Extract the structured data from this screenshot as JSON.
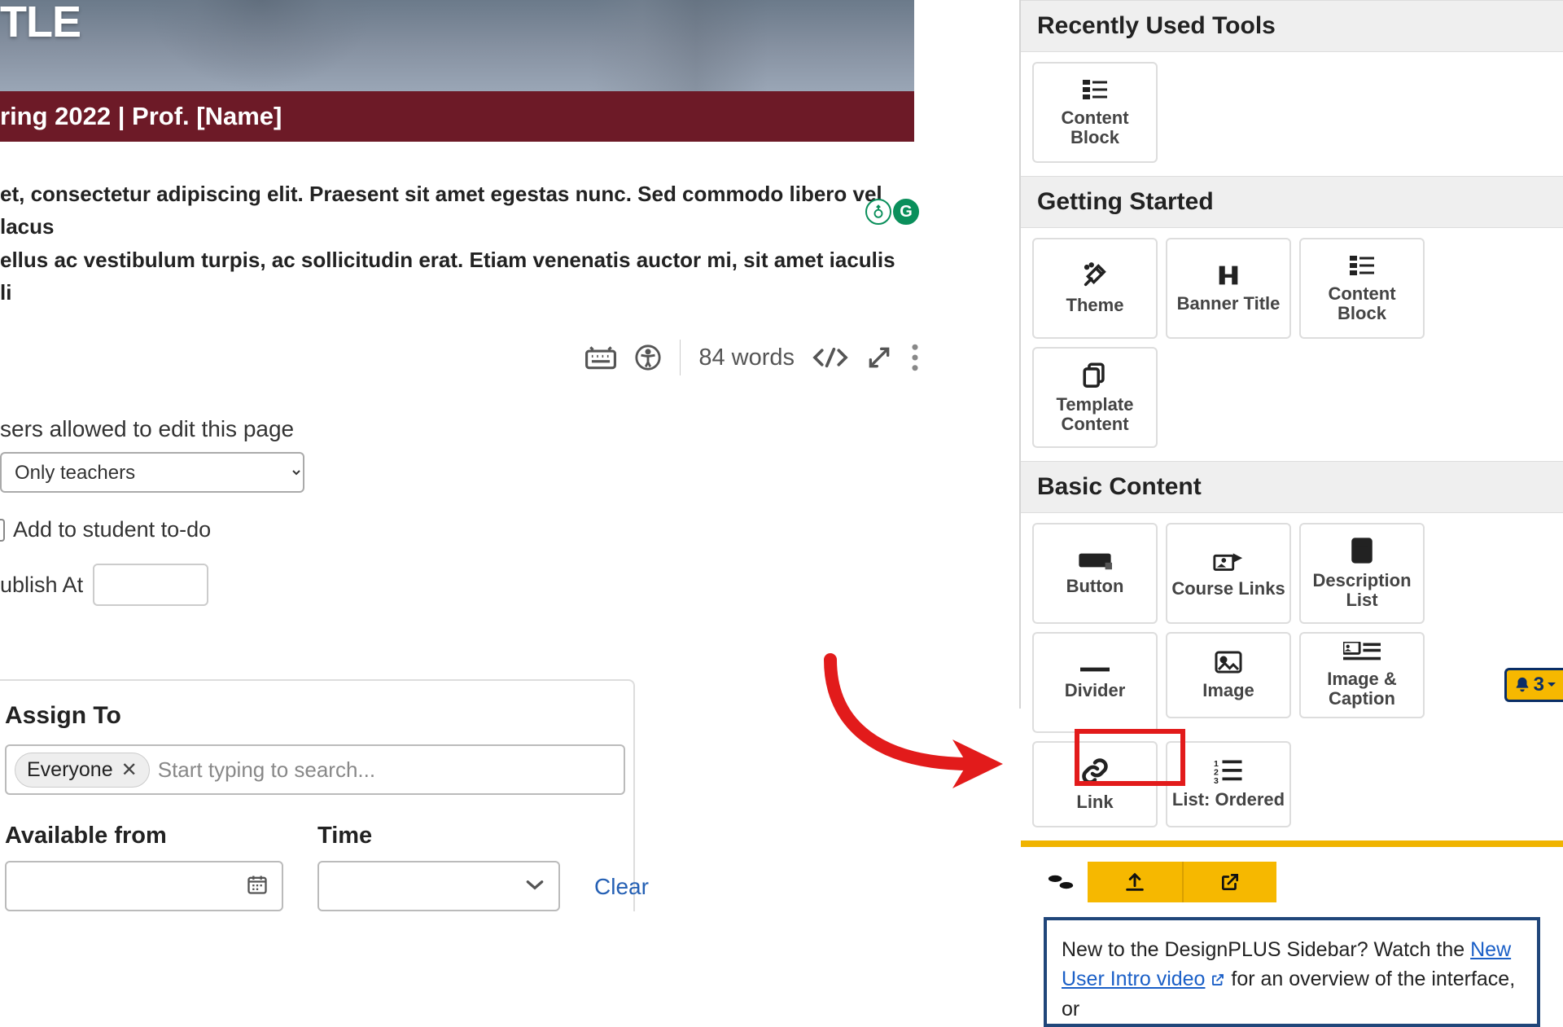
{
  "banner": {
    "title_fragment": "TLE",
    "subtitle": "ring 2022 | Prof. [Name]"
  },
  "body_text_line1": "et, consectetur adipiscing elit. Praesent sit amet egestas nunc. Sed commodo libero vel lacus",
  "body_text_line2": "ellus ac vestibulum turpis, ac sollicitudin erat. Etiam venenatis auctor mi, sit amet iaculis li",
  "editor_footer": {
    "word_count": "84 words"
  },
  "form": {
    "edit_label": "sers allowed to edit this page",
    "select_value": "Only teachers",
    "todo_label": "Add to student to-do",
    "publish_label": "ublish At"
  },
  "assign": {
    "heading": "Assign To",
    "token": "Everyone",
    "placeholder": "Start typing to search...",
    "available_label": "Available from",
    "time_label": "Time",
    "clear": "Clear"
  },
  "sidebar": {
    "sections": {
      "recent": "Recently Used Tools",
      "getting_started": "Getting Started",
      "basic": "Basic Content"
    },
    "tools": {
      "content_block": "Content\nBlock",
      "theme": "Theme",
      "banner_title": "Banner Title",
      "template_content": "Template\nContent",
      "button": "Button",
      "course_links": "Course Links",
      "description_list": "Description\nList",
      "divider": "Divider",
      "image": "Image",
      "image_caption": "Image &\nCaption",
      "link": "Link",
      "list_ordered": "List: Ordered"
    },
    "message": {
      "prefix": "New to the DesignPLUS Sidebar? Watch the ",
      "link1": "New User Intro video",
      "suffix": " for an overview of the interface, or"
    },
    "notification_count": "3"
  }
}
